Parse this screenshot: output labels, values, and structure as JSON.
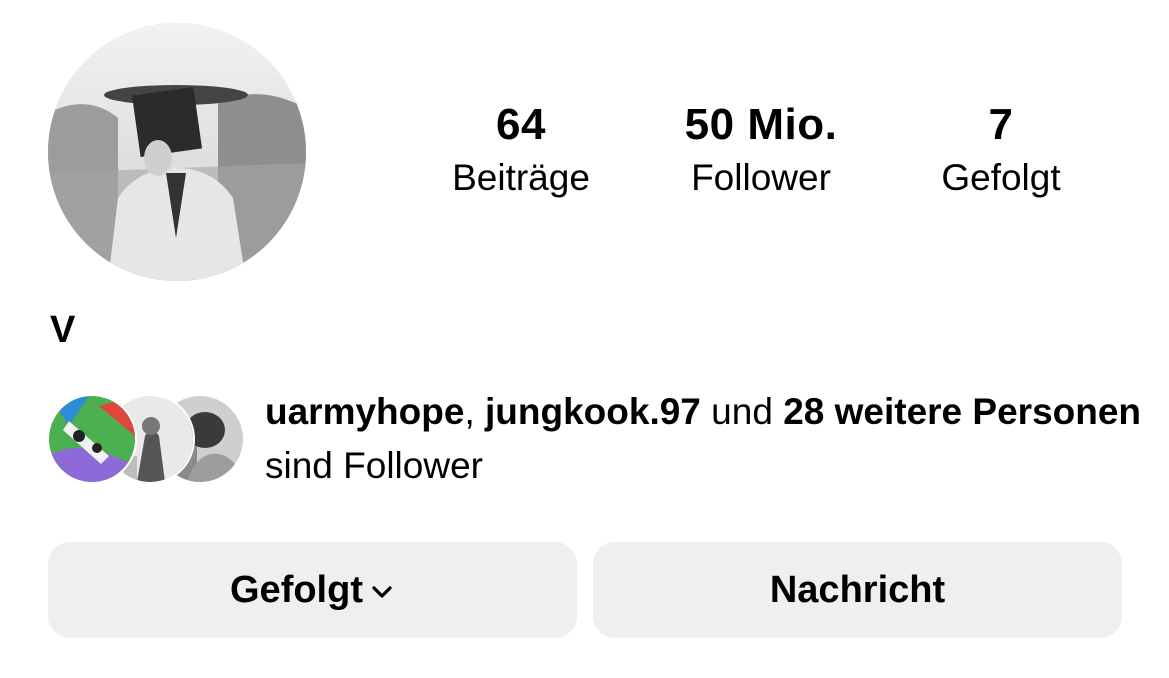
{
  "profile": {
    "name": "V",
    "avatar_icon": "profile-photo-grayscale"
  },
  "stats": {
    "posts": {
      "value": "64",
      "label": "Beiträge"
    },
    "followers": {
      "value": "50 Mio.",
      "label": "Follower"
    },
    "following": {
      "value": "7",
      "label": "Gefolgt"
    }
  },
  "followed_by": {
    "user1": "uarmyhope",
    "separator": ", ",
    "user2": "jungkook.97",
    "and": " und ",
    "others": "28 weitere Personen",
    "suffix": " sind Follower"
  },
  "buttons": {
    "follow_label": "Gefolgt",
    "follow_icon": "chevron-down-icon",
    "message_label": "Nachricht"
  },
  "colors": {
    "background": "#ffffff",
    "text": "#000000",
    "button_bg": "#efefef"
  }
}
